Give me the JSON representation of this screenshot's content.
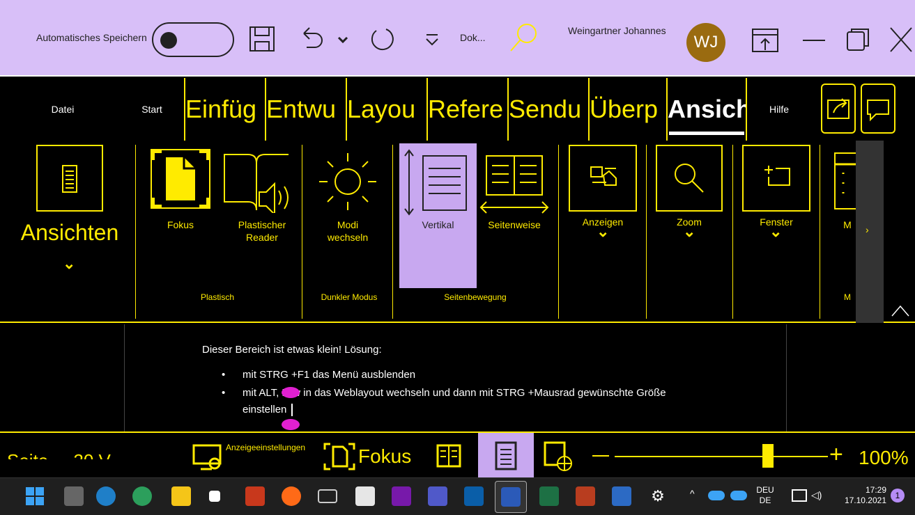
{
  "titlebar": {
    "autosave_label": "Automatisches Speichern",
    "doc_name": "Dok...",
    "user_name": "Weingartner Johannes",
    "avatar_initials": "WJ"
  },
  "tabs": [
    {
      "label": "Datei"
    },
    {
      "label": "Start"
    },
    {
      "label": "Einfüg"
    },
    {
      "label": "Entwu"
    },
    {
      "label": "Layou"
    },
    {
      "label": "Refere"
    },
    {
      "label": "Sendu"
    },
    {
      "label": "Überp"
    },
    {
      "label": "Ansich"
    },
    {
      "label": "Hilfe"
    }
  ],
  "ribbon": {
    "views_label": "Ansichten",
    "buttons": {
      "fokus": "Fokus",
      "reader_line1": "Plastischer",
      "reader_line2": "Reader",
      "modi_line1": "Modi",
      "modi_line2": "wechseln",
      "vertikal": "Vertikal",
      "seitenweise": "Seitenweise",
      "anzeigen": "Anzeigen",
      "zoom": "Zoom",
      "fenster": "Fenster",
      "m": "M"
    },
    "groups": {
      "plastisch": "Plastisch",
      "dunkler": "Dunkler Modus",
      "seitenbewegung": "Seitenbewegung",
      "m": "M"
    }
  },
  "document": {
    "line1": "Dieser Bereich ist etwas klein! Lösung:",
    "bullet1": "mit STRG +F1 das Menü ausblenden",
    "bullet2a": "mit ALT, F, w in das Weblayout wechseln und dann mit STRG +Mausrad gewünschte Größe",
    "bullet2b": "einstellen"
  },
  "statusbar": {
    "page_info": "Seite ... 20 V",
    "display_settings": "Anzeigeeinstellungen",
    "focus": "Fokus",
    "zoom_level": "100%",
    "zoom_value": 0.72
  },
  "taskbar": {
    "lang_line1": "DEU",
    "lang_line2": "DE",
    "time": "17:29",
    "date": "17.10.2021",
    "notifications": "1"
  },
  "colors": {
    "accent": "#FFEB00",
    "titlebar": "#D8BFF8",
    "selected": "#C8A8F0"
  }
}
